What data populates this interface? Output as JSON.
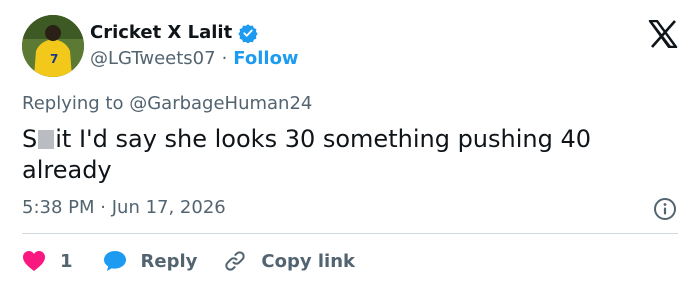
{
  "tweet": {
    "author_name": "Cricket X Lalit",
    "handle": "@LGTweets07",
    "separator": "·",
    "follow_label": "Follow",
    "replying_prefix": "Replying to",
    "replying_to": "@GarbageHuman24",
    "text_censored_start": "S",
    "text_rest": "it I'd say she looks 30 something pushing 40 already",
    "time": "5:38 PM",
    "date_separator": "·",
    "date": "Jun 17, 2026"
  },
  "actions": {
    "like_count": "1",
    "reply_label": "Reply",
    "copy_label": "Copy link"
  },
  "colors": {
    "accent": "#1d9bf0",
    "like": "#f91880",
    "secondary_text": "#536471",
    "primary_text": "#0f1419",
    "divider": "#cfd9de"
  },
  "icons": [
    "avatar",
    "verified-icon",
    "x-logo-icon",
    "info-icon",
    "heart-icon",
    "reply-bubble-icon",
    "link-icon"
  ]
}
